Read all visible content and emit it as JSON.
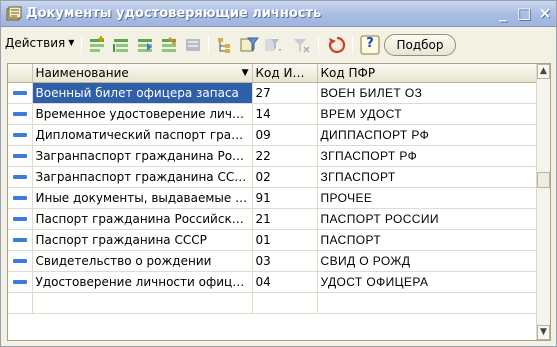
{
  "window": {
    "title": "Документы удостоверяющие личность",
    "minimize": "_",
    "maximize": "□",
    "close": "×"
  },
  "toolbar": {
    "actions_label": "Действия",
    "podbor_label": "Подбор",
    "help_label": "?"
  },
  "table": {
    "columns": [
      "Наименование",
      "Код ИФНС",
      "Код ПФР"
    ],
    "selected_row": 0,
    "rows": [
      {
        "name": "Военный билет офицера запаса",
        "ifns": "27",
        "pfr": "ВОЕН БИЛЕТ ОЗ"
      },
      {
        "name": "Временное удостоверение личност...",
        "ifns": "14",
        "pfr": "ВРЕМ УДОСТ"
      },
      {
        "name": "Дипломатический паспорт гражда...",
        "ifns": "09",
        "pfr": "ДИППАСПОРТ РФ"
      },
      {
        "name": "Загранпаспорт гражданина Россий...",
        "ifns": "22",
        "pfr": "ЗГПАСПОРТ РФ"
      },
      {
        "name": "Загранпаспорт гражданина СССР",
        "ifns": "02",
        "pfr": "ЗГПАСПОРТ"
      },
      {
        "name": "Иные документы, выдаваемые орг...",
        "ifns": "91",
        "pfr": "ПРОЧЕЕ"
      },
      {
        "name": "Паспорт гражданина Российской ...",
        "ifns": "21",
        "pfr": "ПАСПОРТ РОССИИ"
      },
      {
        "name": "Паспорт гражданина СССР",
        "ifns": "01",
        "pfr": "ПАСПОРТ"
      },
      {
        "name": "Свидетельство о рождении",
        "ifns": "03",
        "pfr": "СВИД О РОЖД"
      },
      {
        "name": "Удостоверение личности офицера",
        "ifns": "04",
        "pfr": "УДОСТ ОФИЦЕРА"
      }
    ]
  },
  "colors": {
    "title_bar": "#a9bde3",
    "selection": "#2f5fa8",
    "row_icon": "#3c7ddb"
  }
}
